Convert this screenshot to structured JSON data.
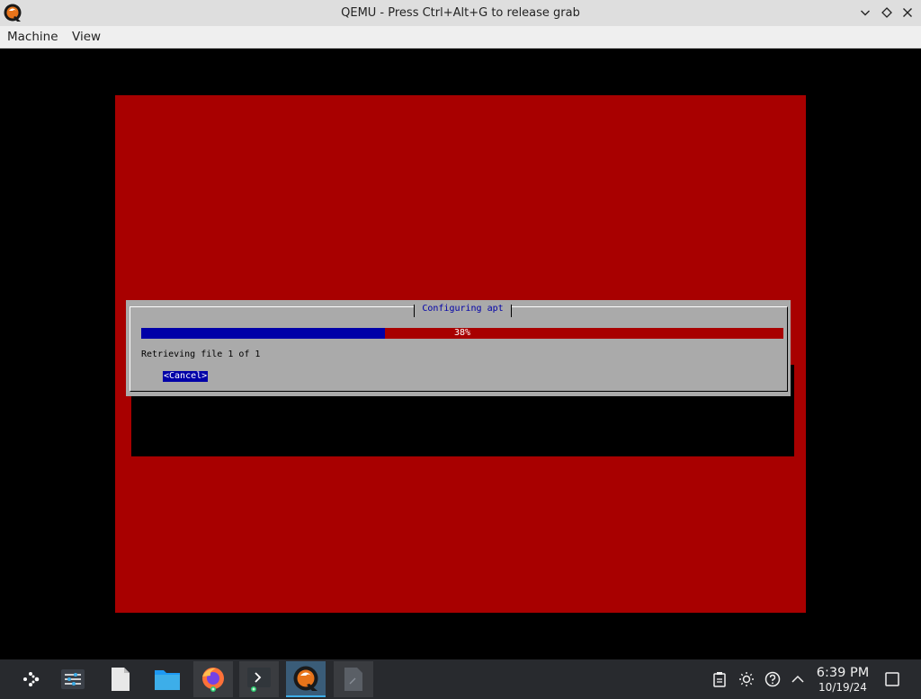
{
  "window": {
    "title": "QEMU - Press Ctrl+Alt+G to release grab",
    "icon": "qemu-icon",
    "controls": [
      "minimize-icon",
      "maximize-icon",
      "close-icon"
    ]
  },
  "menubar": {
    "items": [
      "Machine",
      "View"
    ]
  },
  "installer": {
    "dialog_title": "Configuring apt",
    "progress_percent": 38,
    "progress_label": "38%",
    "status": "Retrieving file 1 of 1",
    "cancel_label": "<Cancel>",
    "colors": {
      "background": "#a80000",
      "dialog": "#aaaaaa",
      "progress_fill": "#0000a8"
    }
  },
  "taskbar": {
    "launcher_icon": "application-launcher-icon",
    "apps": [
      {
        "icon": "system-settings-icon"
      },
      {
        "icon": "text-document-icon"
      },
      {
        "icon": "file-manager-icon"
      },
      {
        "icon": "firefox-icon"
      },
      {
        "icon": "terminal-icon"
      },
      {
        "icon": "qemu-icon",
        "active": true
      },
      {
        "icon": "text-editor-icon"
      }
    ],
    "tray": [
      "clipboard-icon",
      "brightness-icon",
      "updates-icon",
      "expand-tray-icon"
    ],
    "clock": {
      "time": "6:39 PM",
      "date": "10/19/24"
    },
    "show_desktop_icon": "show-desktop-icon"
  }
}
